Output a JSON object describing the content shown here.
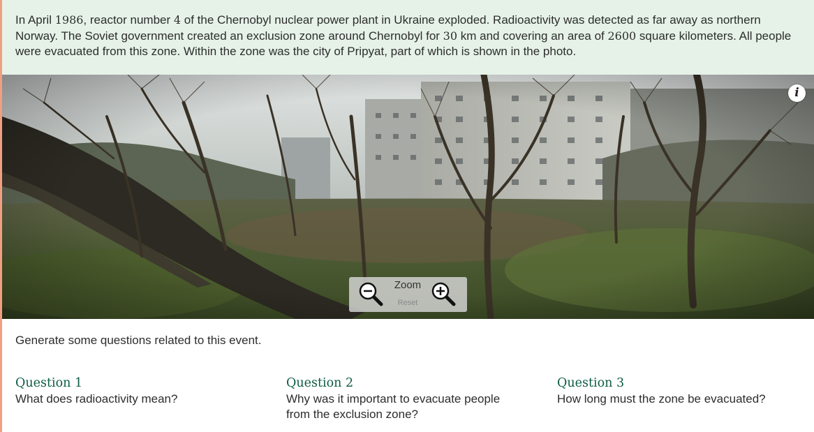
{
  "intro": {
    "s1": "In April ",
    "n1": "1986",
    "s2": ", reactor number ",
    "n2": "4",
    "s3": " of the Chernobyl nuclear power plant in Ukraine exploded. Radioactivity was detected as far away as northern Norway. The Soviet government created an exclusion zone around Chernobyl for ",
    "n3": "30",
    "s4": " km and covering an area of ",
    "n4": "2600",
    "s5": " square kilometers. All people were evacuated from this zone. Within the zone was the city of Pripyat, part of which is shown in the photo."
  },
  "photo": {
    "info_glyph": "i",
    "zoom_label": "Zoom",
    "reset_label": "Reset",
    "zoom_out_icon": "zoom-out-magnifier-icon",
    "zoom_in_icon": "zoom-in-magnifier-icon"
  },
  "prompt": "Generate some questions related to this event.",
  "questions": [
    {
      "title": "Question 1",
      "text": "What does radioactivity mean?"
    },
    {
      "title": "Question 2",
      "text": "Why was it important to evacuate people from the exclusion zone?"
    },
    {
      "title": "Question 3",
      "text": "How long must the zone be evacuated?"
    }
  ],
  "colors": {
    "intro_bg": "#e6f2e8",
    "question_title": "#0c5b44",
    "left_accent": "#f0a080"
  }
}
